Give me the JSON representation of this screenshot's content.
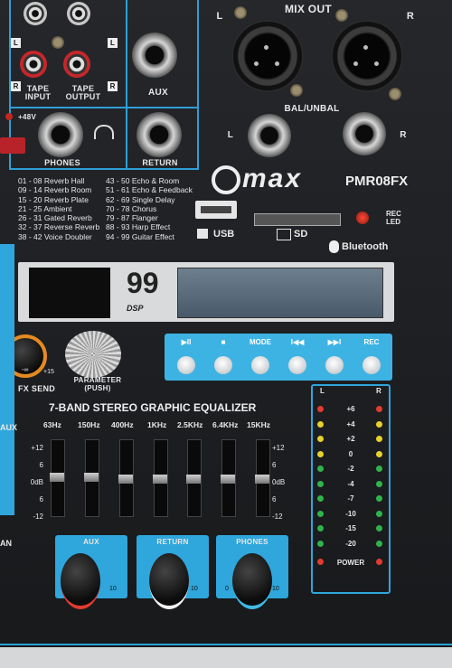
{
  "rear": {
    "tape_input": "TAPE\nINPUT",
    "tape_output": "TAPE\nOUTPUT",
    "aux_label": "AUX",
    "phones_label": "PHONES",
    "return_label": "RETURN",
    "plus48v": "+48V",
    "mix_out": "MIX OUT",
    "bal_unbal": "BAL/UNBAL",
    "l": "L",
    "r": "R"
  },
  "effects_list": [
    "01 - 08  Reverb Hall",
    "09 - 14  Reverb Room",
    "15 - 20  Reverb Plate",
    "21 - 25  Ambient",
    "26 - 31  Gated Reverb",
    "32 - 37  Reverse Reverb",
    "38 - 42  Voice Doubler"
  ],
  "effects_list_2": [
    "43 - 50  Echo & Room",
    "51 - 61  Echo & Feedback",
    "62 - 69  Single Delay",
    "70 - 78  Chorus",
    "79 - 87  Flanger",
    "88 - 93  Harp Effect",
    "94 - 99  Guitar Effect"
  ],
  "brand": {
    "logo": "max",
    "model": "PMR08FX",
    "rec_led": "REC\nLED",
    "usb": "USB",
    "sd": "SD",
    "bluetooth": "Bluetooth"
  },
  "dsp": {
    "display": "99",
    "label": "DSP"
  },
  "fx": {
    "send": "FX SEND",
    "min": "-∞",
    "max": "+15",
    "parameter": "PARAMETER\n(PUSH)"
  },
  "transport": {
    "buttons": [
      "▶II",
      "■",
      "MODE",
      "I◀◀",
      "▶▶I",
      "REC"
    ]
  },
  "eq": {
    "title": "7-BAND STEREO GRAPHIC EQUALIZER",
    "bands": [
      "63Hz",
      "150Hz",
      "400Hz",
      "1KHz",
      "2.5KHz",
      "6.4KHz",
      "15KHz"
    ],
    "scale_left": [
      "+12",
      "6",
      "0dB",
      "6",
      "-12"
    ],
    "scale_right": [
      "+12",
      "6",
      "0dB",
      "6",
      "-12"
    ]
  },
  "knobs": {
    "aux": "AUX",
    "return": "RETURN",
    "phones": "PHONES",
    "min": "0",
    "max": "10"
  },
  "vu": {
    "l": "L",
    "r": "R",
    "levels": [
      "+6",
      "+4",
      "+2",
      "0",
      "-2",
      "-4",
      "-7",
      "-10",
      "-15",
      "-20"
    ],
    "power": "POWER"
  },
  "colors": {
    "accent_blue": "#2fa6dc",
    "led_red": "#e23b2f",
    "led_yellow": "#e7d12c",
    "led_green": "#2fb44a"
  },
  "side": {
    "aux": "AUX",
    "an": "AN"
  }
}
